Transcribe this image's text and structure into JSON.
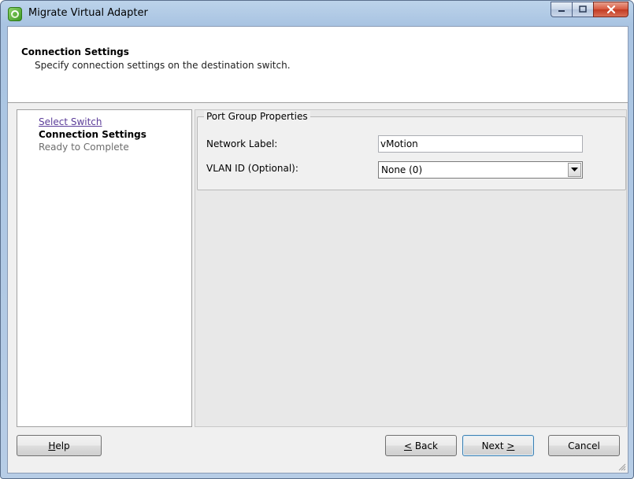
{
  "window": {
    "title": "Migrate Virtual Adapter",
    "icon": "vmware-vsphere-icon"
  },
  "caption_buttons": {
    "minimize": "minimize-icon",
    "maximize": "maximize-icon",
    "close": "close-icon"
  },
  "header": {
    "title": "Connection Settings",
    "subtitle": "Specify connection settings on the destination switch."
  },
  "nav": {
    "items": [
      {
        "label": "Select Switch",
        "state": "visited-link"
      },
      {
        "label": "Connection Settings",
        "state": "current"
      },
      {
        "label": "Ready to Complete",
        "state": "upcoming"
      }
    ]
  },
  "port_group": {
    "legend": "Port Group Properties",
    "network_label": {
      "label": "Network Label:",
      "value": "vMotion"
    },
    "vlan_id": {
      "label": "VLAN ID (Optional):",
      "value": "None (0)"
    }
  },
  "buttons": {
    "help": {
      "prefix": "",
      "mnemonic": "H",
      "rest": "elp"
    },
    "back": {
      "prefix": "",
      "mnemonic": "<",
      "rest": " Back"
    },
    "next": {
      "prefix": "Next ",
      "mnemonic": ">",
      "rest": ""
    },
    "cancel": "Cancel"
  },
  "colors": {
    "link": "#5b3c99",
    "upcoming": "#6d6d6d",
    "default_button_border": "#3c7fb1"
  }
}
